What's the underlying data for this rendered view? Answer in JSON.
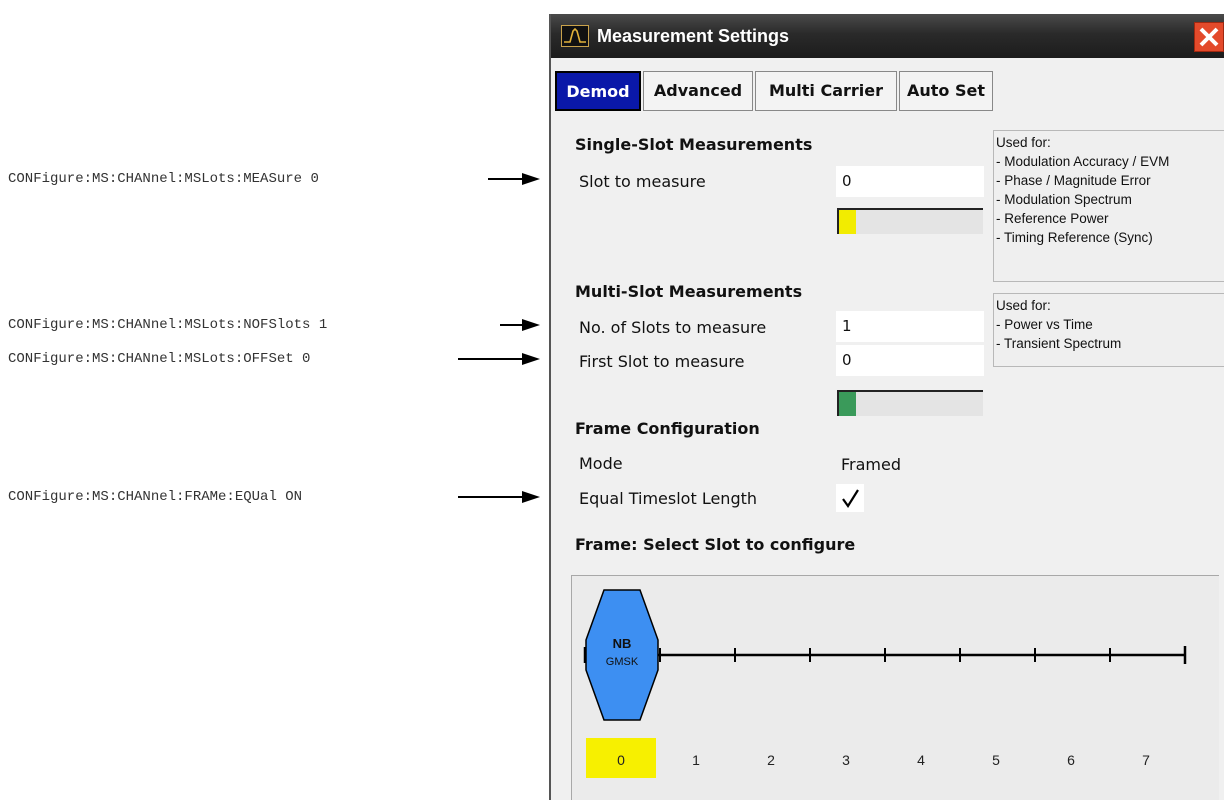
{
  "annotations": [
    {
      "command": "CONFigure:MS:CHANnel:MSLots:MEASure 0"
    },
    {
      "command": "CONFigure:MS:CHANnel:MSLots:NOFSlots 1"
    },
    {
      "command": "CONFigure:MS:CHANnel:MSLots:OFFSet 0"
    },
    {
      "command": "CONFigure:MS:CHANnel:FRAMe:EQUal ON"
    }
  ],
  "dialog": {
    "title": "Measurement Settings",
    "icons": {
      "app": "spectrum-icon",
      "close": "close-icon"
    },
    "tabs": [
      {
        "label": "Demod",
        "active": true
      },
      {
        "label": "Advanced",
        "active": false
      },
      {
        "label": "Multi Carrier",
        "active": false
      },
      {
        "label": "Auto Set",
        "active": false
      }
    ],
    "single_slot": {
      "heading": "Single-Slot Measurements",
      "slot_label": "Slot to measure",
      "slot_value": "0",
      "indicator_color": "#f2ec00",
      "used_for_title": "Used for:",
      "used_for": [
        "- Modulation Accuracy / EVM",
        "- Phase / Magnitude Error",
        "- Modulation Spectrum",
        "- Reference Power",
        "- Timing Reference (Sync)"
      ]
    },
    "multi_slot": {
      "heading": "Multi-Slot Measurements",
      "num_label": "No. of Slots to measure",
      "num_value": "1",
      "first_label": "First Slot to measure",
      "first_value": "0",
      "indicator_color": "#3a9a5a",
      "used_for_title": "Used for:",
      "used_for": [
        "- Power vs Time",
        "- Transient Spectrum"
      ]
    },
    "frame_config": {
      "heading": "Frame Configuration",
      "mode_label": "Mode",
      "mode_value": "Framed",
      "equal_label": "Equal Timeslot Length",
      "equal_checked": true
    },
    "frame": {
      "heading": "Frame: Select Slot to configure",
      "burst_type": "NB",
      "modulation": "GMSK",
      "burst_color": "#3d8ff2",
      "slots": [
        "0",
        "1",
        "2",
        "3",
        "4",
        "5",
        "6",
        "7"
      ],
      "selected_slot": "0",
      "selected_color": "#f7f000"
    }
  }
}
